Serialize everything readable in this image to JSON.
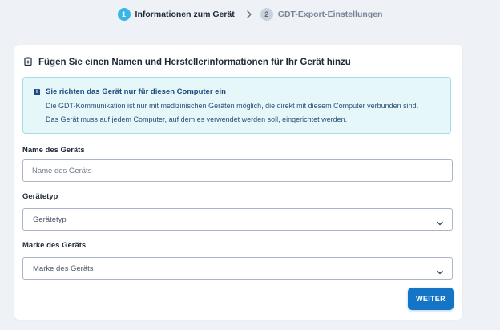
{
  "stepper": {
    "steps": [
      {
        "number": "1",
        "label": "Informationen zum Gerät",
        "state": "active"
      },
      {
        "number": "2",
        "label": "GDT-Export-Einstellungen",
        "state": "inactive"
      }
    ]
  },
  "form": {
    "title": "Fügen Sie einen Namen und Herstellerinformationen für Ihr Gerät hinzu",
    "info": {
      "title": "Sie richten das Gerät nur für diesen Computer ein",
      "line1": "Die GDT-Kommunikation ist nur mit medizinischen Geräten möglich, die direkt mit diesem Computer verbunden sind.",
      "line2": "Das Gerät muss auf jedem Computer, auf dem es verwendet werden soll, eingerichtet werden."
    },
    "device_name": {
      "label": "Name des Geräts",
      "placeholder": "Name des Geräts",
      "value": ""
    },
    "device_type": {
      "label": "Gerätetyp",
      "selected": "Gerätetyp"
    },
    "device_brand": {
      "label": "Marke des Geräts",
      "selected": "Marke des Geräts"
    },
    "next_button": "WEITER"
  },
  "colors": {
    "accent": "#1475c7",
    "step_active": "#38b6e6",
    "info_bg": "#e6f7fa",
    "info_border": "#9fdde8",
    "page_bg": "#eef1f6"
  },
  "icons": {
    "title_icon": "clipboard-plus-icon",
    "info_icon": "info-icon",
    "step_separator": "chevron-right-icon",
    "select_arrow": "chevron-down-icon"
  }
}
